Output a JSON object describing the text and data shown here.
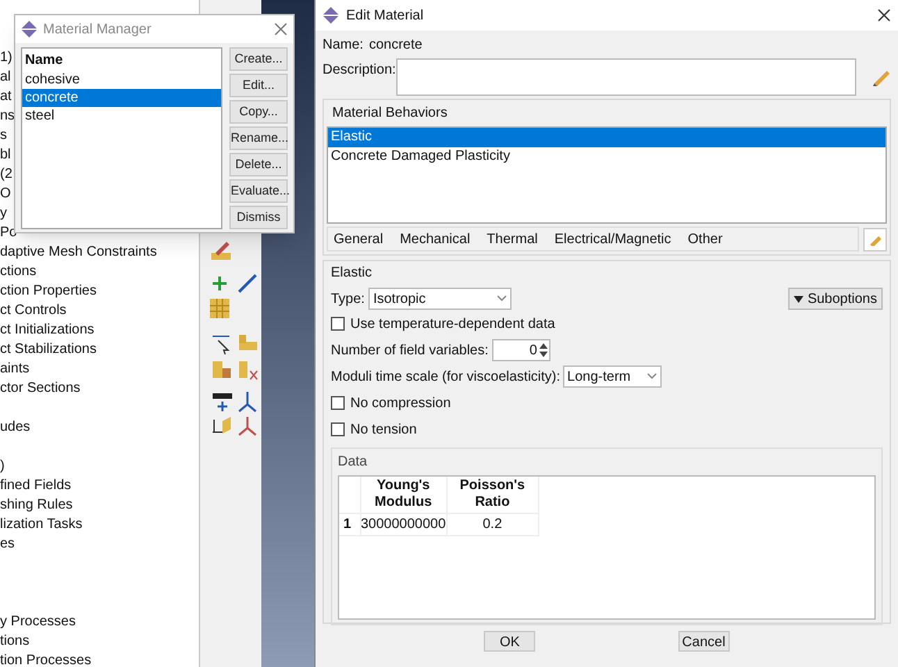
{
  "model_tree": {
    "groups": [
      [
        "1)",
        "al",
        "at",
        "ns",
        "s",
        "bl",
        "(2",
        "O",
        "y",
        "Po",
        "daptive Mesh Constraints",
        "ctions",
        "ction Properties",
        "ct Controls",
        "ct Initializations",
        "ct Stabilizations",
        "aints",
        "ctor Sections"
      ],
      [
        "udes"
      ],
      [
        ")",
        "fined Fields",
        "shing Rules",
        "lization Tasks",
        "es"
      ],
      [
        "y Processes",
        "tions",
        "tion Processes"
      ]
    ]
  },
  "material_manager": {
    "title": "Material Manager",
    "column": "Name",
    "items": [
      {
        "label": "cohesive",
        "selected": false
      },
      {
        "label": "concrete",
        "selected": true
      },
      {
        "label": "steel",
        "selected": false
      }
    ],
    "buttons": [
      "Create...",
      "Edit...",
      "Copy...",
      "Rename...",
      "Delete...",
      "Evaluate...",
      "Dismiss"
    ]
  },
  "edit_material": {
    "title": "Edit Material",
    "name_label": "Name:",
    "name_value": "concrete",
    "description_label": "Description:",
    "behaviors": {
      "title": "Material Behaviors",
      "items": [
        {
          "label": "Elastic",
          "selected": true
        },
        {
          "label": "Concrete Damaged Plasticity",
          "selected": false
        }
      ]
    },
    "menu": [
      "General",
      "Mechanical",
      "Thermal",
      "Electrical/Magnetic",
      "Other"
    ],
    "section": {
      "title": "Elastic",
      "type_label": "Type:",
      "type_value": "Isotropic",
      "suboptions": "Suboptions",
      "options": [
        {
          "kind": "checkbox",
          "label": "Use temperature-dependent data",
          "checked": false
        },
        {
          "kind": "spinner",
          "label": "Number of field variables:",
          "value": "0"
        },
        {
          "kind": "dropdown",
          "label": "Moduli time scale (for viscoelasticity):",
          "value": "Long-term"
        },
        {
          "kind": "checkbox",
          "label": "No compression",
          "checked": false
        },
        {
          "kind": "checkbox",
          "label": "No tension",
          "checked": false
        }
      ],
      "data": {
        "title": "Data",
        "columns": [
          "Young's Modulus",
          "Poisson's Ratio"
        ],
        "rows": [
          {
            "index": "1",
            "cells": [
              "30000000000",
              "0.2"
            ]
          }
        ]
      }
    },
    "buttons": [
      "OK",
      "Cancel"
    ]
  }
}
